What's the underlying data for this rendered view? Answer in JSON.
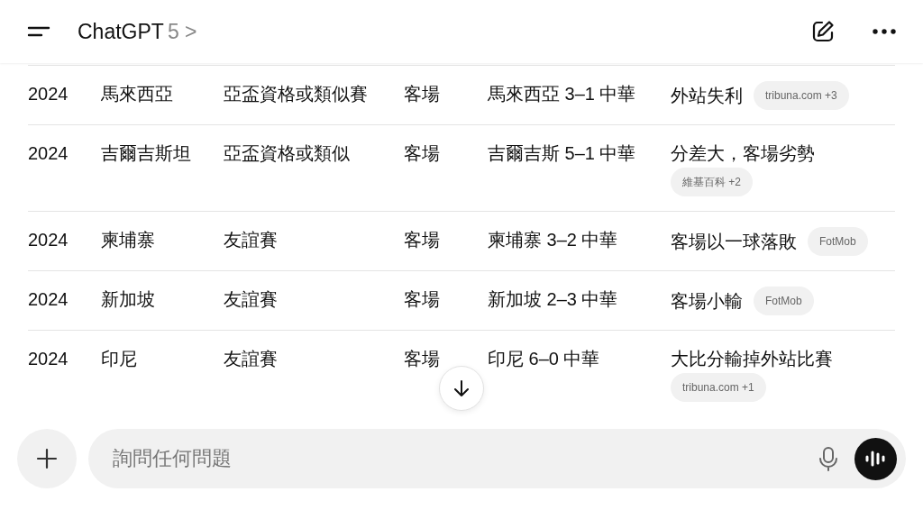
{
  "header": {
    "title": "ChatGPT",
    "version": "5 >"
  },
  "table": {
    "rows": [
      {
        "year": "2024",
        "opponent": "馬來西亞",
        "competition": "亞盃資格或類似賽",
        "venue": "客場",
        "score": "馬來西亞 3–1 中華",
        "note": "外站失利",
        "source": "tribuna.com +3"
      },
      {
        "year": "2024",
        "opponent": "吉爾吉斯坦",
        "competition": "亞盃資格或類似",
        "venue": "客場",
        "score": "吉爾吉斯 5–1 中華",
        "note": "分差大，客場劣勢",
        "source": "維基百科 +2"
      },
      {
        "year": "2024",
        "opponent": "柬埔寨",
        "competition": "友誼賽",
        "venue": "客場",
        "score": "柬埔寨 3–2 中華",
        "note": "客場以一球落敗",
        "source": "FotMob"
      },
      {
        "year": "2024",
        "opponent": "新加坡",
        "competition": "友誼賽",
        "venue": "客場",
        "score": "新加坡 2–3 中華",
        "note": "客場小輸",
        "source": "FotMob"
      },
      {
        "year": "2024",
        "opponent": "印尼",
        "competition": "友誼賽",
        "venue": "客場",
        "score": "印尼 6–0 中華",
        "note": "大比分輸掉外站比賽",
        "source": "tribuna.com +1"
      }
    ]
  },
  "composer": {
    "placeholder": "詢問任何問題"
  }
}
